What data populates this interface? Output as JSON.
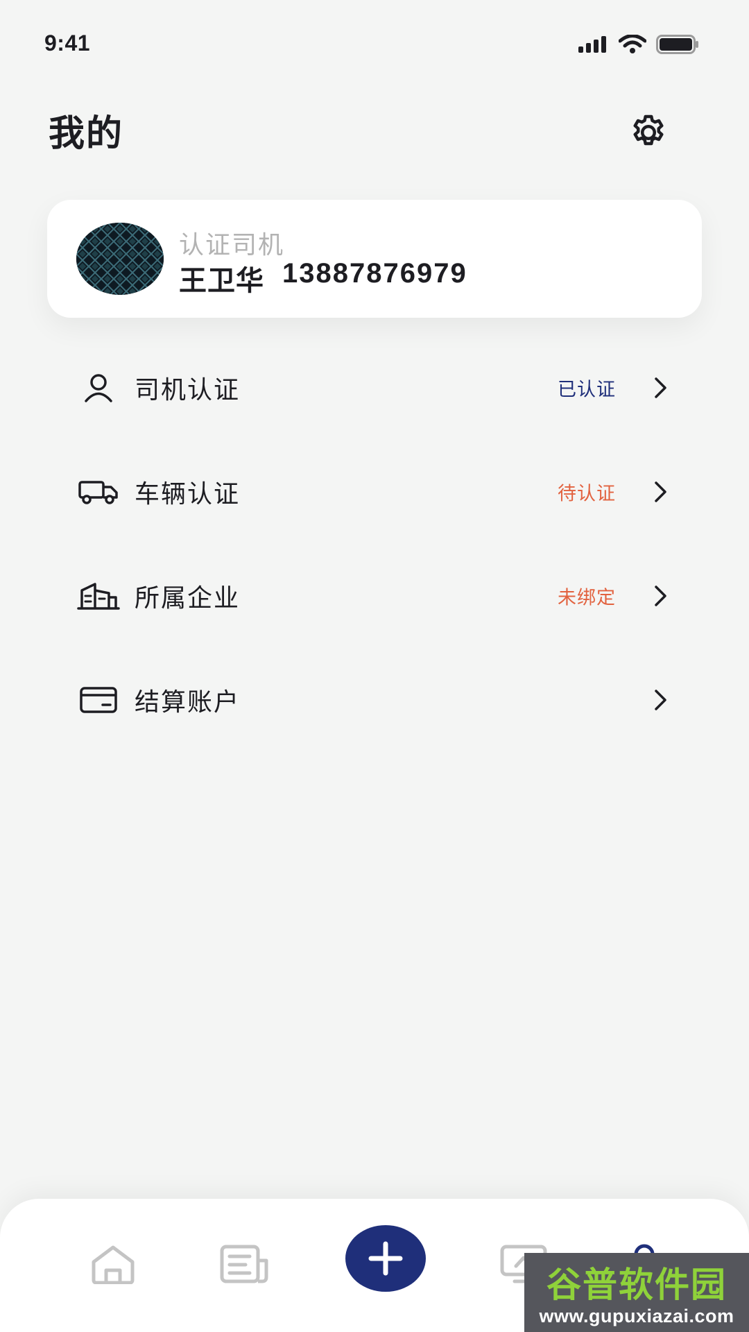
{
  "status_bar": {
    "time": "9:41"
  },
  "header": {
    "title": "我的",
    "settings_icon": "gear-icon"
  },
  "profile": {
    "role": "认证司机",
    "name": "王卫华",
    "phone": "13887876979"
  },
  "menu": {
    "items": [
      {
        "label": "司机认证",
        "status": "已认证",
        "status_color": "#1f2f7a",
        "icon": "user-icon"
      },
      {
        "label": "车辆认证",
        "status": "待认证",
        "status_color": "#e2623f",
        "icon": "truck-icon"
      },
      {
        "label": "所属企业",
        "status": "未绑定",
        "status_color": "#e2623f",
        "icon": "building-icon"
      },
      {
        "label": "结算账户",
        "status": "",
        "status_color": "",
        "icon": "card-icon"
      }
    ]
  },
  "tab_bar": {
    "tabs": [
      "home-icon",
      "orders-icon",
      "add-icon",
      "monitor-icon",
      "profile-icon"
    ],
    "accent": "#1f2f7a"
  },
  "watermark": {
    "title": "谷普软件园",
    "url": "www.gupuxiazai.com"
  }
}
